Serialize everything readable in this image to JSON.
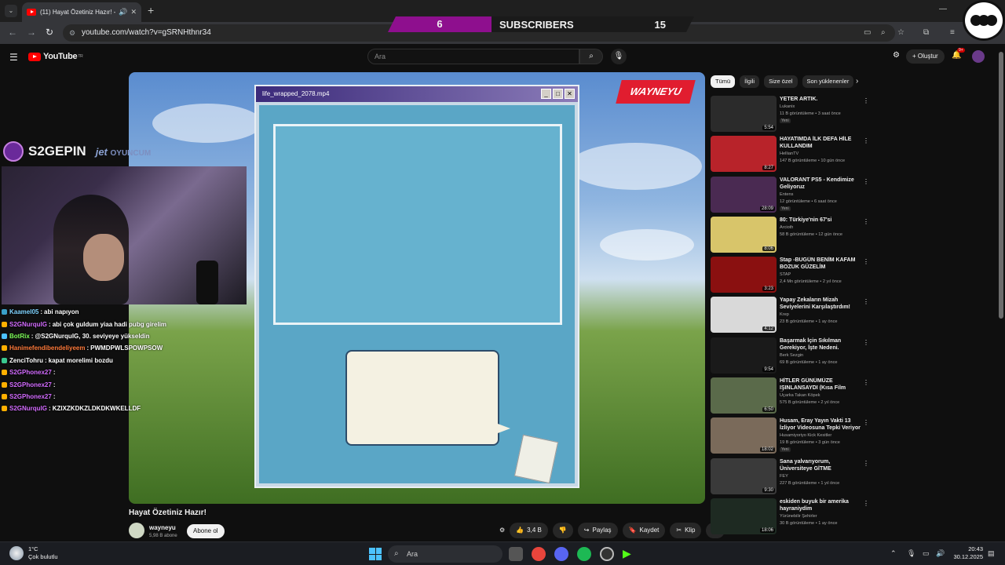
{
  "browser": {
    "tab_title": "(11) Hayat Özetiniz Hazır! -",
    "url": "youtube.com/watch?v=gSRNHthnr34"
  },
  "overlay": {
    "sub_left": "6",
    "sub_label": "SUBSCRIBERS",
    "sub_right": "15",
    "stream_brand": "S2GEPIN",
    "sponsor": "jet",
    "sponsor_sub": "OYUNCUM"
  },
  "youtube": {
    "logo_text": "YouTube",
    "logo_region": "TR",
    "search_placeholder": "Ara",
    "create_label": "Oluştur",
    "notif_count": "9+"
  },
  "video": {
    "window_title": "life_wrapped_2078.mp4",
    "badge": "WAYNEYU",
    "title": "Hayat Özetiniz Hazır!",
    "channel": "wayneyu",
    "channel_subs": "5,98 B abone",
    "subscribe_label": "Abone ol",
    "likes": "3,4 B",
    "share_label": "Paylaş",
    "save_label": "Kaydet",
    "clip_label": "Klip"
  },
  "chat": [
    {
      "user": "Kaamel05",
      "text": "abi napıyon",
      "color": "#7fd3ff",
      "badge": "#3aa0c8"
    },
    {
      "user": "S2GNurqulG",
      "text": "abi çok guldum yiaa hadi pubg girelim",
      "color": "#d36bff",
      "badge": "#ffb000"
    },
    {
      "user": "BotRix",
      "text": "@S2GNurqulG, 30. seviyeye yükseldin",
      "color": "#7fff5a",
      "badge": "#4cc2ff"
    },
    {
      "user": "Hanimefendibendeliyeem",
      "text": "PWMDPWLSPOWPSOW",
      "color": "#ff7a3a",
      "badge": "#ffb000"
    },
    {
      "user": "ZenciTohru",
      "text": "kapat morelimi bozdu",
      "color": "#ffffff",
      "badge": "#3ac88f"
    },
    {
      "user": "S2GPhonex27",
      "text": "",
      "color": "#d36bff",
      "badge": "#ffb000"
    },
    {
      "user": "S2GPhonex27",
      "text": "",
      "color": "#d36bff",
      "badge": "#ffb000"
    },
    {
      "user": "S2GPhonex27",
      "text": "",
      "color": "#d36bff",
      "badge": "#ffb000"
    },
    {
      "user": "S2GNurqulG",
      "text": "KZIXZKDKZLDKDKWKELLDF",
      "color": "#d36bff",
      "badge": "#ffb000"
    }
  ],
  "chips": [
    "Tümü",
    "İlgili",
    "Size özel",
    "Son yüklenenler"
  ],
  "rail": [
    {
      "title": "YETER ARTIK.",
      "channel": "Lukanix",
      "meta": "11 B görüntüleme • 3 saat önce",
      "new": "Yeni",
      "dur": "5:54",
      "thumb": "#2b2b2b"
    },
    {
      "title": "HAYATIMDA İLK DEFA HİLE KULLANDIM",
      "channel": "HellianTV",
      "meta": "147 B görüntüleme • 10 gün önce",
      "new": "",
      "dur": "8:27",
      "thumb": "#b8232a"
    },
    {
      "title": "VALORANT PS5 - Kendimize Geliyoruz",
      "channel": "Entens",
      "meta": "12 görüntüleme • 6 saat önce",
      "new": "Yeni",
      "dur": "28:09",
      "thumb": "#4a2a52"
    },
    {
      "title": "80: Türkiye'nin 67'si",
      "channel": "Arcioth",
      "meta": "58 B görüntüleme • 12 gün önce",
      "new": "",
      "dur": "8:06",
      "thumb": "#d8c56a"
    },
    {
      "title": "Stap -BUGÜN BENİM KAFAM BOZUK GÜZELİM",
      "channel": "STAP",
      "meta": "2,4 Mn görüntüleme • 2 yıl önce",
      "new": "",
      "dur": "3:23",
      "thumb": "#8a1010"
    },
    {
      "title": "Yapay Zekaların Mizah Seviyelerini Karşılaştırdım!",
      "channel": "Krep",
      "meta": "23 B görüntüleme • 1 ay önce",
      "new": "",
      "dur": "4:12",
      "thumb": "#d9d9d9"
    },
    {
      "title": "Başarmak İçin Sıkılman Gerekiyor, İşte Nedeni.",
      "channel": "Berk Sezgin",
      "meta": "69 B görüntüleme • 1 ay önce",
      "new": "",
      "dur": "9:54",
      "thumb": "#1a1a1a"
    },
    {
      "title": "HİTLER GÜNÜMÜZE IŞINLANSAYDI (Kısa Film Özeti)",
      "channel": "Uçarka Takan Köpek",
      "meta": "575 B görüntüleme • 2 yıl önce",
      "new": "",
      "dur": "6:50",
      "thumb": "#5a6a4a"
    },
    {
      "title": "Husam, Eray Yayın Vakti 13 İzliyor Videosuna Tepki Veriyor",
      "channel": "Husamiyoriyo Kick Kesitler",
      "meta": "19 B görüntüleme • 3 gün önce",
      "new": "Yeni",
      "dur": "18:02",
      "thumb": "#7a6a5a"
    },
    {
      "title": "Sana yalvarıyorum, Üniversiteye GİTME",
      "channel": "FEY",
      "meta": "227 B görüntüleme • 1 yıl önce",
      "new": "",
      "dur": "9:30",
      "thumb": "#3a3a3a"
    },
    {
      "title": "eskiden buyuk bir amerika hayraniydim",
      "channel": "Yürünebilir Şehirler",
      "meta": "30 B görüntüleme • 1 ay önce",
      "new": "",
      "dur": "18:06",
      "thumb": "#1e2a22"
    }
  ],
  "taskbar": {
    "temp": "1°C",
    "weather": "Çok bulutlu",
    "search": "Ara",
    "time": "20:43",
    "date": "30.12.2025"
  }
}
